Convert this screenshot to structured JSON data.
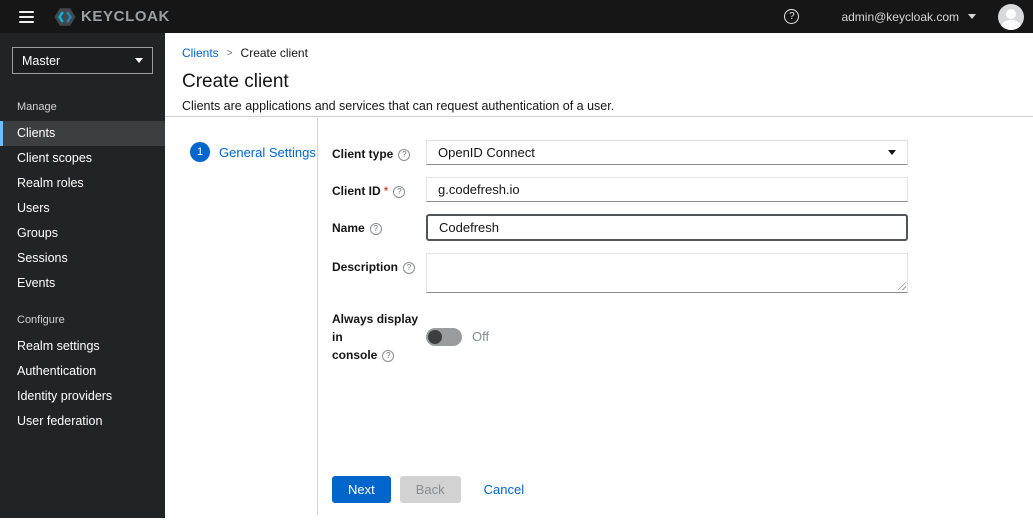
{
  "topbar": {
    "brand": "KEYCLOAK",
    "help_glyph": "?",
    "user_email": "admin@keycloak.com"
  },
  "sidebar": {
    "realm": "Master",
    "sections": [
      {
        "title": "Manage",
        "items": [
          "Clients",
          "Client scopes",
          "Realm roles",
          "Users",
          "Groups",
          "Sessions",
          "Events"
        ]
      },
      {
        "title": "Configure",
        "items": [
          "Realm settings",
          "Authentication",
          "Identity providers",
          "User federation"
        ]
      }
    ],
    "active_item": "Clients"
  },
  "breadcrumb": {
    "parent": "Clients",
    "separator": ">",
    "current": "Create client"
  },
  "page": {
    "title": "Create client",
    "subtitle": "Clients are applications and services that can request authentication of a user."
  },
  "wizard": {
    "step_number": "1",
    "step_label": "General Settings"
  },
  "form": {
    "client_type": {
      "label": "Client type",
      "value": "OpenID Connect"
    },
    "client_id": {
      "label": "Client ID",
      "required_marker": "*",
      "value": "g.codefresh.io"
    },
    "name": {
      "label": "Name",
      "value": "Codefresh"
    },
    "description": {
      "label": "Description",
      "value": ""
    },
    "always_display": {
      "label_line1": "Always display in",
      "label_line2": "console",
      "state": "Off"
    }
  },
  "actions": {
    "next": "Next",
    "back": "Back",
    "cancel": "Cancel"
  },
  "colors": {
    "accent": "#0066cc",
    "topbar_bg": "#161616",
    "sidebar_bg": "#212427",
    "active_nav_bg": "#3c3f42",
    "active_nav_border": "#73bcf7",
    "required": "#c9190b",
    "brand_cyan": "#00b9e4"
  }
}
